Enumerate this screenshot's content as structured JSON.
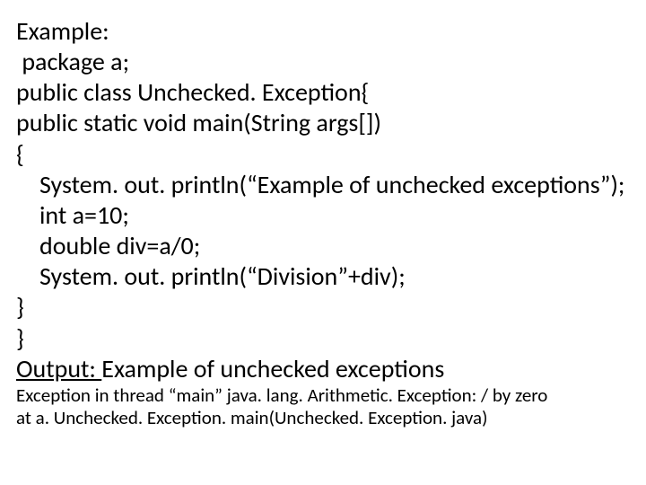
{
  "lines": {
    "l1": "Example:",
    "l2": " package a;",
    "l3": "public class Unchecked. Exception{",
    "l4": "public static void main(String args[])",
    "l5": "{",
    "l6": "System. out. println(“Example of unchecked exceptions”);",
    "l7": "int a=10;",
    "l8": "double div=a/0;",
    "l9": "System. out. println(“Division”+div);",
    "l10": "}",
    "l11": "}",
    "output_label": "Output: ",
    "output_text": "Example of unchecked exceptions",
    "s1": "Exception in thread “main” java. lang. Arithmetic. Exception: / by zero",
    "s2": "at a. Unchecked. Exception. main(Unchecked. Exception. java)"
  }
}
